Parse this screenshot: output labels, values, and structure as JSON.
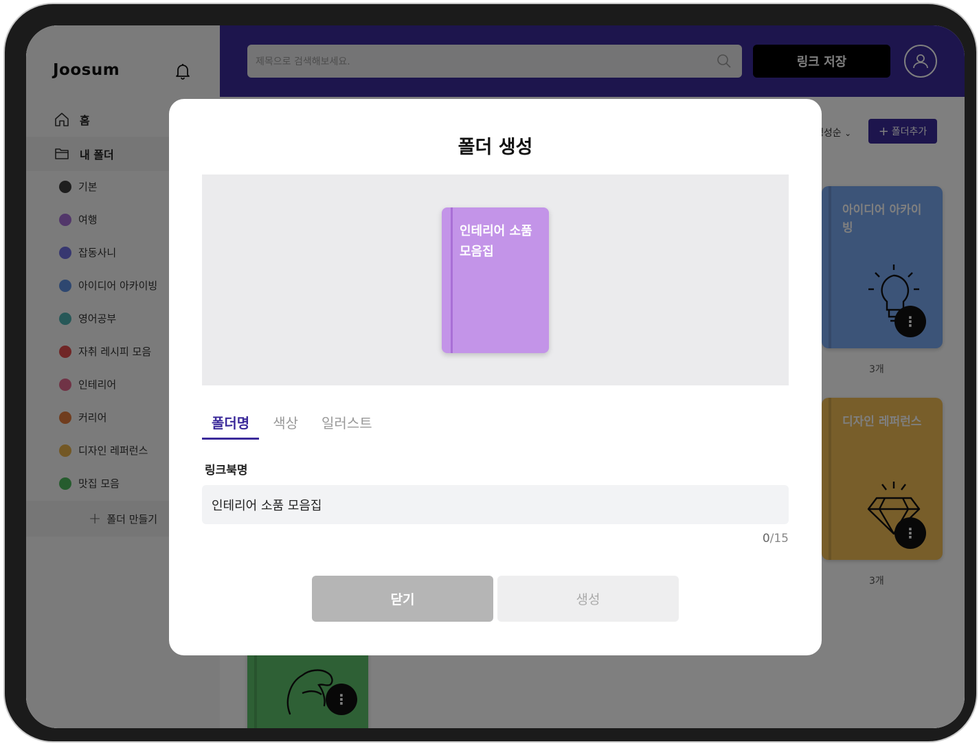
{
  "sidebar": {
    "logo": "Joosum",
    "nav": [
      {
        "label": "홈"
      },
      {
        "label": "내 폴더"
      }
    ],
    "folders": [
      {
        "label": "기본",
        "color": "#3c3c3c"
      },
      {
        "label": "여행",
        "color": "#a56fd4"
      },
      {
        "label": "잡동사니",
        "color": "#6f6fe0"
      },
      {
        "label": "아이디어 아카이빙",
        "color": "#5c8ee0"
      },
      {
        "label": "영어공부",
        "color": "#4fb0b0"
      },
      {
        "label": "자취 레시피 모음",
        "color": "#e04c4c"
      },
      {
        "label": "인테리어",
        "color": "#e0668c"
      },
      {
        "label": "커리어",
        "color": "#e07a3c"
      },
      {
        "label": "디자인 레퍼런스",
        "color": "#e6b04a"
      },
      {
        "label": "맛집 모음",
        "color": "#4cb85c"
      }
    ],
    "make_folder": "폴더 만들기"
  },
  "header": {
    "search_placeholder": "제목으로 검색해보세요.",
    "save_label": "링크 저장"
  },
  "main": {
    "sort_label": "생성순",
    "add_folder_label": "폴더추가",
    "cards": [
      {
        "title": "아이디어 아카이빙",
        "count": "3개",
        "color": "#79a8f0",
        "illustration": "lightbulb-icon"
      },
      {
        "title": "디자인 레퍼런스",
        "count": "3개",
        "color": "#f0bd55",
        "illustration": "diamond-icon"
      },
      {
        "title": "",
        "count": "",
        "color": "#5cc06a",
        "illustration": "muscle-icon"
      }
    ]
  },
  "modal": {
    "title": "폴더 생성",
    "preview_title": "인테리어 소품 모음집",
    "preview_color": "#c394e8",
    "tabs": [
      {
        "label": "폴더명",
        "active": true
      },
      {
        "label": "색상",
        "active": false
      },
      {
        "label": "일러스트",
        "active": false
      }
    ],
    "field_label": "링크북명",
    "field_value": "인테리어 소품 모음집",
    "counter_current": "0",
    "counter_max": "/15",
    "close_label": "닫기",
    "create_label": "생성"
  }
}
